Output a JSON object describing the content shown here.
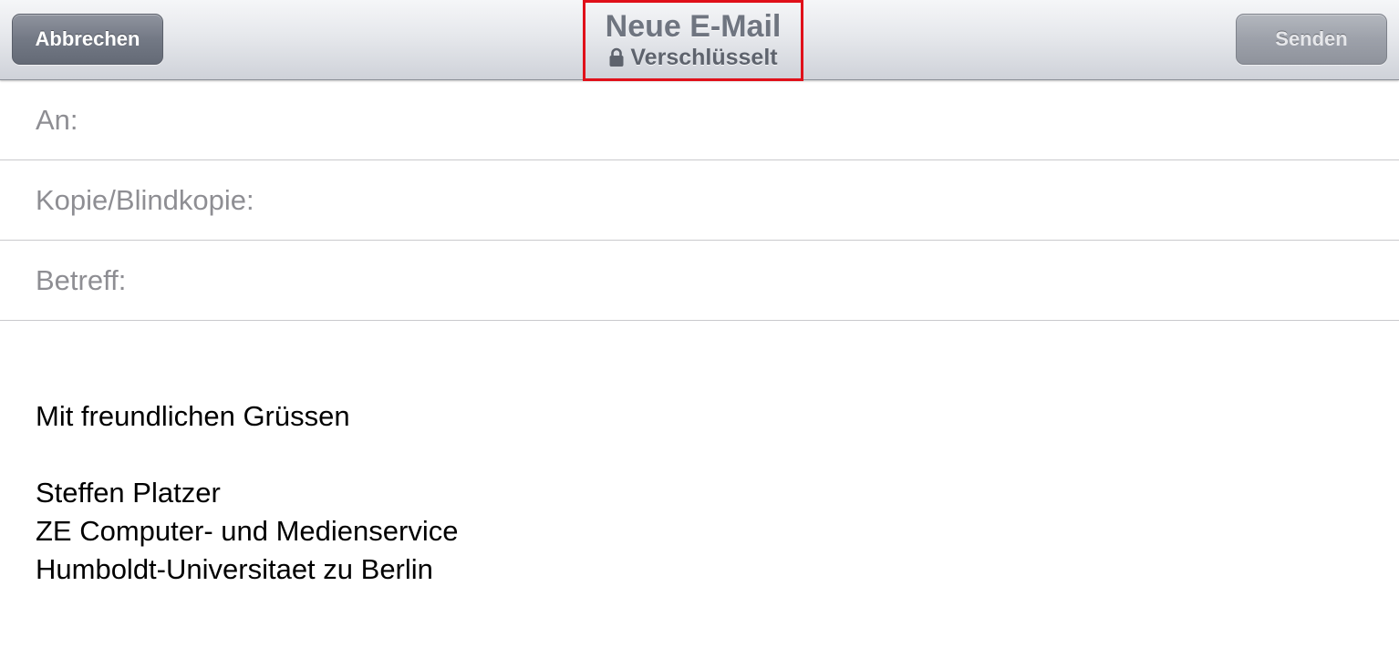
{
  "toolbar": {
    "cancel_label": "Abbrechen",
    "send_label": "Senden",
    "title": "Neue E-Mail",
    "subtitle": "Verschlüsselt",
    "subtitle_icon": "lock-icon",
    "highlight_color": "#e0101a"
  },
  "fields": {
    "to_label": "An:",
    "cc_label": "Kopie/Blindkopie:",
    "subject_label": "Betreff:"
  },
  "body": {
    "greeting": "Mit freundlichen Grüssen",
    "name": "Steffen Platzer",
    "department": "ZE Computer- und Medienservice",
    "institution": "Humboldt-Universitaet zu Berlin"
  }
}
